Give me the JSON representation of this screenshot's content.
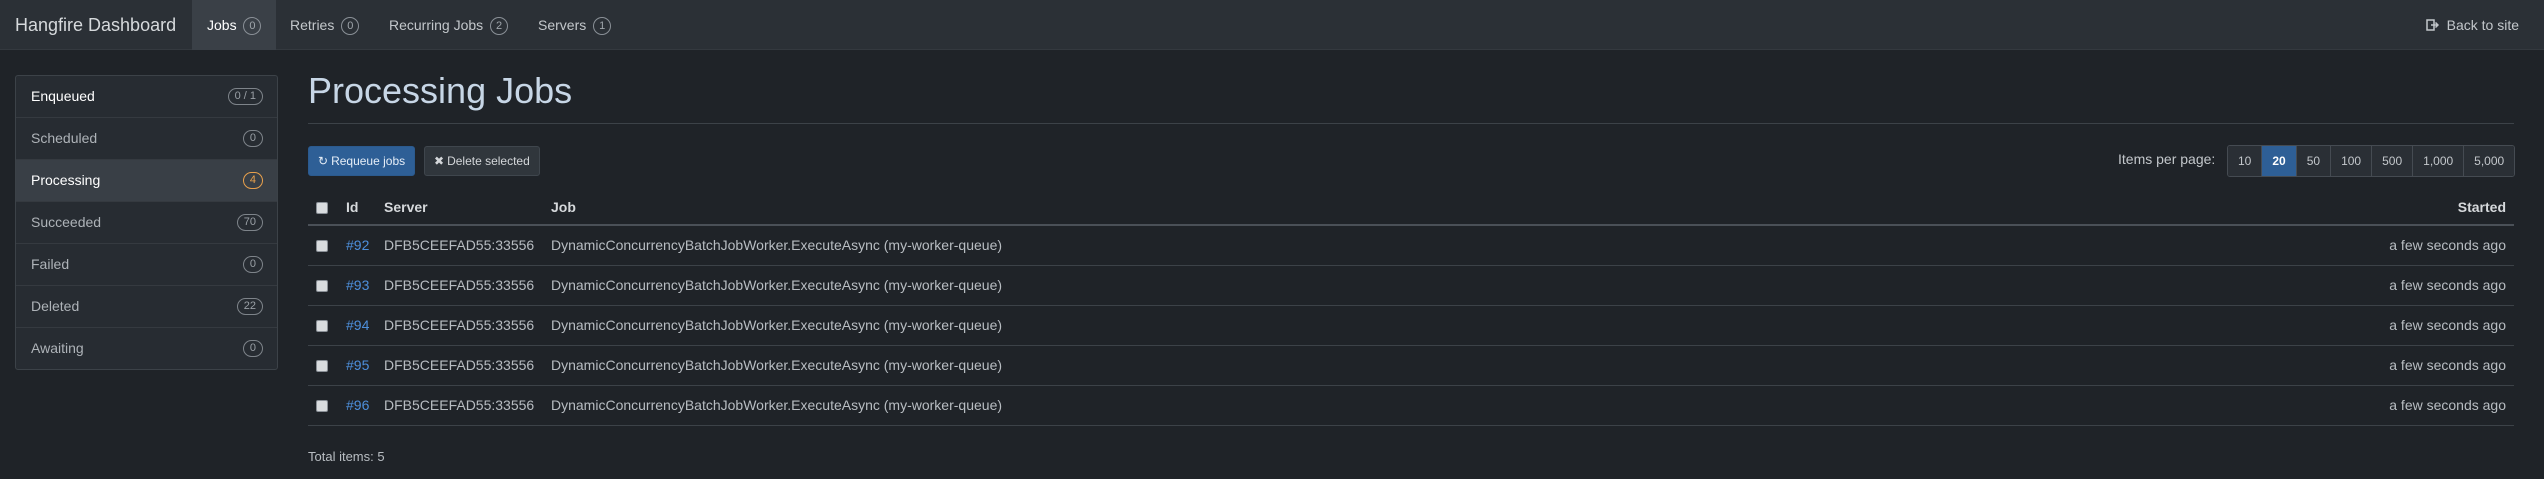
{
  "navbar": {
    "brand": "Hangfire Dashboard",
    "items": [
      {
        "label": "Jobs",
        "badge": "0"
      },
      {
        "label": "Retries",
        "badge": "0"
      },
      {
        "label": "Recurring Jobs",
        "badge": "2"
      },
      {
        "label": "Servers",
        "badge": "1"
      }
    ],
    "back_link": "Back to site",
    "back_icon": "sign-out-icon"
  },
  "sidebar": {
    "items": [
      {
        "label": "Enqueued",
        "badge": "0 / 1"
      },
      {
        "label": "Scheduled",
        "badge": "0"
      },
      {
        "label": "Processing",
        "badge": "4"
      },
      {
        "label": "Succeeded",
        "badge": "70"
      },
      {
        "label": "Failed",
        "badge": "0"
      },
      {
        "label": "Deleted",
        "badge": "22"
      },
      {
        "label": "Awaiting",
        "badge": "0"
      }
    ]
  },
  "main": {
    "title": "Processing Jobs",
    "requeue_label": "Requeue jobs",
    "requeue_icon": "refresh-icon",
    "delete_label": "Delete selected",
    "delete_icon": "times-icon",
    "items_per_page_label": "Items per page:",
    "page_sizes": [
      "10",
      "20",
      "50",
      "100",
      "500",
      "1,000",
      "5,000"
    ],
    "selected_page_size": "20",
    "table": {
      "headers": {
        "id": "Id",
        "server": "Server",
        "job": "Job",
        "started": "Started"
      },
      "rows": [
        {
          "id": "#92",
          "server": "DFB5CEEFAD55:33556",
          "job": "DynamicConcurrencyBatchJobWorker.ExecuteAsync (my-worker-queue)",
          "started": "a few seconds ago"
        },
        {
          "id": "#93",
          "server": "DFB5CEEFAD55:33556",
          "job": "DynamicConcurrencyBatchJobWorker.ExecuteAsync (my-worker-queue)",
          "started": "a few seconds ago"
        },
        {
          "id": "#94",
          "server": "DFB5CEEFAD55:33556",
          "job": "DynamicConcurrencyBatchJobWorker.ExecuteAsync (my-worker-queue)",
          "started": "a few seconds ago"
        },
        {
          "id": "#95",
          "server": "DFB5CEEFAD55:33556",
          "job": "DynamicConcurrencyBatchJobWorker.ExecuteAsync (my-worker-queue)",
          "started": "a few seconds ago"
        },
        {
          "id": "#96",
          "server": "DFB5CEEFAD55:33556",
          "job": "DynamicConcurrencyBatchJobWorker.ExecuteAsync (my-worker-queue)",
          "started": "a few seconds ago"
        }
      ]
    },
    "total_items": "Total items: 5"
  },
  "colors": {
    "accent": "#2e5f96",
    "link": "#4d8fdb",
    "warning": "#e8a04c"
  }
}
